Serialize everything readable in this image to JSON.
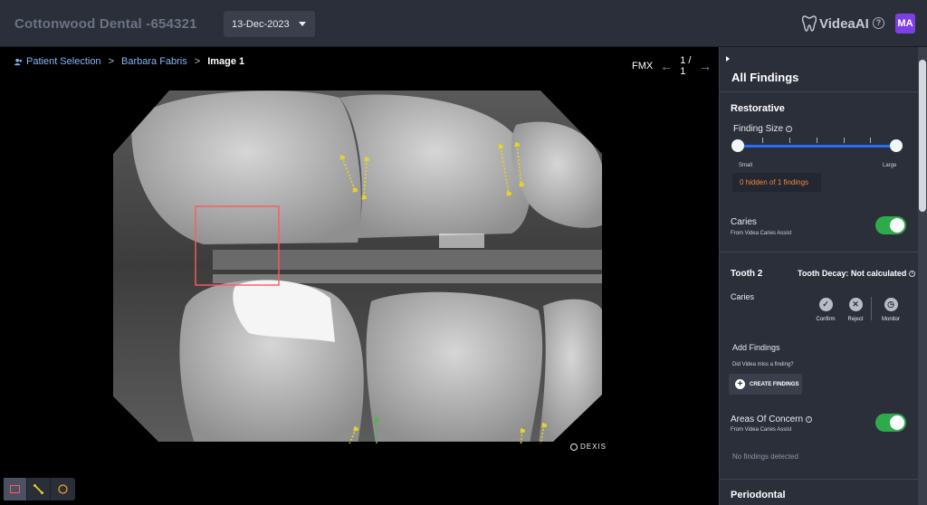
{
  "header": {
    "clinic_title": "Cottonwood Dental -654321",
    "date_value": "13-Dec-2023",
    "brand_name": "VideaAI",
    "help_label": "?",
    "avatar_initials": "MA",
    "colors": {
      "avatar": "#7f3fe6",
      "background": "#2b2f3a"
    }
  },
  "breadcrumb": {
    "items": [
      "Patient Selection",
      "Barbara Fabris",
      "Image 1"
    ],
    "separator": ">"
  },
  "viewer_nav": {
    "series": "FMX",
    "page": "1 / 1"
  },
  "image": {
    "watermark": "DEXIS"
  },
  "toolbox": {
    "tools": [
      "rectangle-tool",
      "measure-tool",
      "circle-tool"
    ],
    "active": "rectangle-tool"
  },
  "panel": {
    "title": "All Findings",
    "restorative": {
      "title": "Restorative",
      "finding_size_label": "Finding Size",
      "slider_min_label": "Small",
      "slider_max_label": "Large",
      "hidden_text": "0 hidden of 1 findings"
    },
    "caries": {
      "label": "Caries",
      "source": "From Videa Caries Assist",
      "enabled": true
    },
    "tooth": {
      "title": "Tooth 2",
      "decay_label": "Tooth Decay: Not calculated",
      "finding_label": "Caries",
      "actions": [
        "Confirm",
        "Reject",
        "Monitor"
      ]
    },
    "add_findings": {
      "title": "Add Findings",
      "question": "Did Videa miss a finding?",
      "button_label": "CREATE FINDINGS"
    },
    "areas_of_concern": {
      "label": "Areas Of Concern",
      "source": "From Videa Caries Assist",
      "enabled": true,
      "empty_text": "No findings detected"
    },
    "periodontal": {
      "title": "Periodontal"
    },
    "colors": {
      "toggle_on": "#2faa4b",
      "slider": "#2a6df4",
      "hidden_text": "#f5873a"
    }
  }
}
